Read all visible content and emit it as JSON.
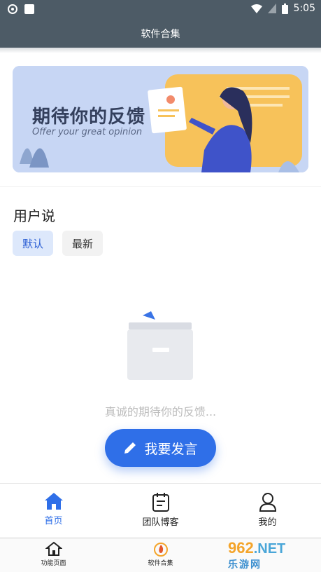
{
  "status_bar": {
    "time": "5:05"
  },
  "title_bar": {
    "title": "软件合集"
  },
  "banner": {
    "title": "期待你的反馈",
    "subtitle": "Offer your great opinion"
  },
  "feedback": {
    "section_title": "用户说",
    "filters": [
      {
        "label": "默认",
        "selected": true
      },
      {
        "label": "最新",
        "selected": false
      }
    ],
    "empty_text": "真诚的期待你的反馈...",
    "post_button": "我要发言"
  },
  "bottom_nav": [
    {
      "label": "首页",
      "icon": "home-icon",
      "active": true
    },
    {
      "label": "团队博客",
      "icon": "notepad-icon",
      "active": false
    },
    {
      "label": "我的",
      "icon": "person-icon",
      "active": false
    }
  ],
  "shell_nav": [
    {
      "label": "功能页面",
      "icon": "house-icon"
    },
    {
      "label": "软件合集",
      "icon": "fire-icon"
    }
  ],
  "watermark": {
    "brand": "962",
    "domain": ".NET",
    "sub": "乐游网"
  },
  "colors": {
    "primary": "#2f6fe8",
    "title_bar": "#4d5b66",
    "chip_selected_bg": "#dde8fb"
  }
}
